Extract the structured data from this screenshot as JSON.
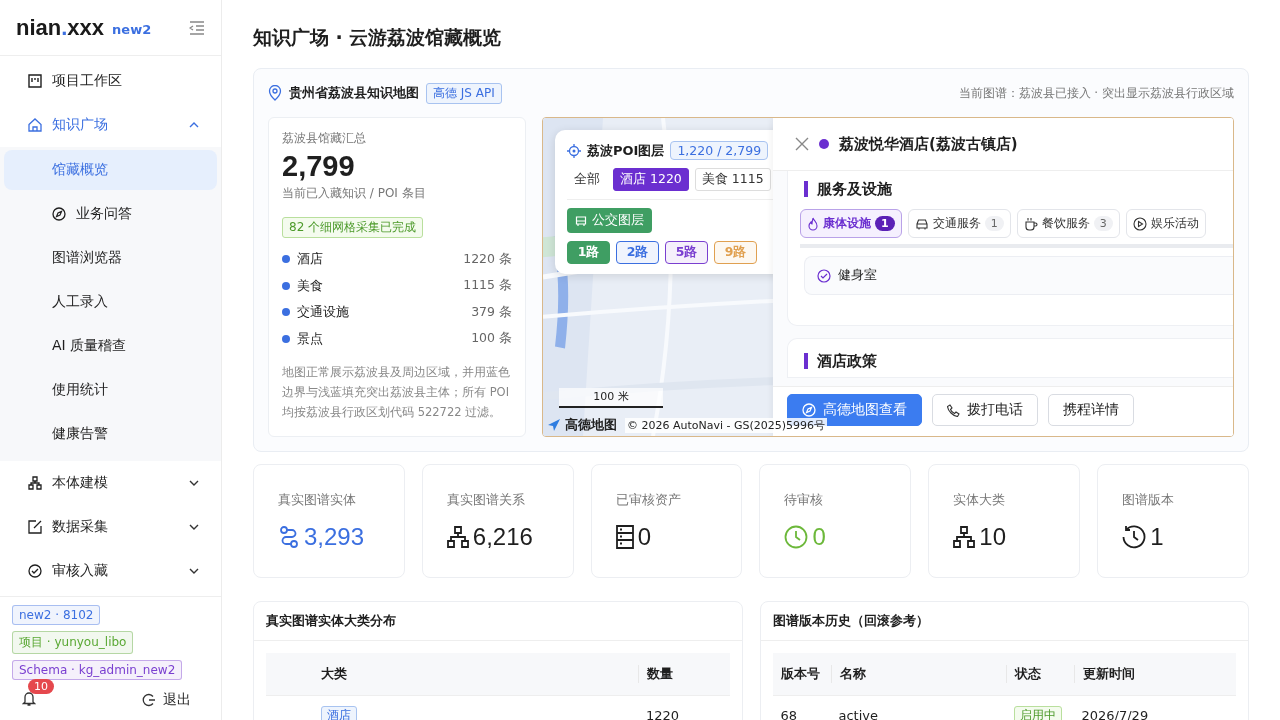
{
  "brand": {
    "name_before_dot": "nian",
    "dot": ".",
    "name_after_dot": "xxx",
    "env": "new2"
  },
  "sidebar": {
    "items": [
      {
        "label": "项目工作区",
        "selected": false
      },
      {
        "label": "知识广场",
        "expanded": true,
        "selected": true,
        "children": [
          {
            "label": "馆藏概览",
            "selected": true
          },
          {
            "label": "业务问答",
            "selected": false
          },
          {
            "label": "图谱浏览器",
            "selected": false
          },
          {
            "label": "人工录入",
            "selected": false
          },
          {
            "label": "AI 质量稽查",
            "selected": false
          },
          {
            "label": "使用统计",
            "selected": false
          },
          {
            "label": "健康告警",
            "selected": false
          }
        ]
      },
      {
        "label": "本体建模",
        "expanded": false,
        "selected": false
      },
      {
        "label": "数据采集",
        "expanded": false,
        "selected": false
      },
      {
        "label": "审核入藏",
        "expanded": false,
        "selected": false
      }
    ]
  },
  "env_tags": [
    {
      "label": "new2 · 8102",
      "color": "#3b6fe0"
    },
    {
      "label": "项目 · yunyou_libo",
      "color": "#5aa834"
    },
    {
      "label": "Schema · kg_admin_new2",
      "color": "#7a3fd0"
    }
  ],
  "footer": {
    "notification_count": "10",
    "logout": "退出"
  },
  "page_title": "知识广场 · 云游荔波馆藏概览",
  "map_card": {
    "title": "贵州省荔波县知识地图",
    "badge": "高德 JS API",
    "note": "当前图谱：荔波县已接入 · 突出显示荔波县行政区域",
    "summary": {
      "label": "荔波县馆藏汇总",
      "total": "2,799",
      "subtitle": "当前已入藏知识 / POI 条目",
      "grid_badge": "82 个细网格采集已完成",
      "categories": [
        {
          "name": "酒店",
          "count": "1220 条",
          "color": "#3b6fe0"
        },
        {
          "name": "美食",
          "count": "1115 条",
          "color": "#3b6fe0"
        },
        {
          "name": "交通设施",
          "count": "379 条",
          "color": "#3b6fe0"
        },
        {
          "name": "景点",
          "count": "100 条",
          "color": "#3b6fe0"
        }
      ],
      "note": "地图正常展示荔波县及周边区域，并用蓝色边界与浅蓝填充突出荔波县主体；所有 POI 均按荔波县行政区划代码 522722 过滤。"
    },
    "map": {
      "kind": "picture",
      "poi_layer": {
        "title": "荔波POI图层",
        "count": "1,220 / 2,799",
        "filters": [
          {
            "label": "全部",
            "selected": false
          },
          {
            "label": "酒店 1220",
            "selected": true
          },
          {
            "label": "美食 1115",
            "selected": false
          }
        ],
        "bus_layer": "公交图层",
        "routes": [
          {
            "label": "1路",
            "selected": true,
            "color": "#3f9e63"
          },
          {
            "label": "2路",
            "selected": false,
            "color": "#3b6fe0"
          },
          {
            "label": "5路",
            "selected": false,
            "color": "#7a3fd0"
          },
          {
            "label": "9路",
            "selected": false,
            "color": "#e0a050"
          }
        ]
      },
      "scale": "100 米",
      "provider": "高德地图",
      "copyright": "© 2026 AutoNavi - GS(2025)5996号"
    },
    "detail": {
      "title": "荔波悦华酒店(荔波古镇店)",
      "color": "#6b2fd0",
      "facility_section": "服务及设施",
      "tabs": [
        {
          "label": "康体设施",
          "count": "1",
          "selected": true
        },
        {
          "label": "交通服务",
          "count": "1",
          "selected": false
        },
        {
          "label": "餐饮服务",
          "count": "3",
          "selected": false
        },
        {
          "label": "娱乐活动",
          "selected": false
        }
      ],
      "facilities": [
        "健身室"
      ],
      "policy_section": "酒店政策",
      "buttons": [
        {
          "label": "高德地图查看",
          "kind": "primary"
        },
        {
          "label": "拨打电话",
          "kind": "phone"
        },
        {
          "label": "携程详情",
          "kind": "plain"
        }
      ]
    }
  },
  "stats": [
    {
      "label": "真实图谱实体",
      "value": "3,293",
      "color": "#3b6fe0"
    },
    {
      "label": "真实图谱关系",
      "value": "6,216",
      "color": "#1f1f1f"
    },
    {
      "label": "已审核资产",
      "value": "0",
      "color": "#1f1f1f"
    },
    {
      "label": "待审核",
      "value": "0",
      "color": "#6cb83a"
    },
    {
      "label": "实体大类",
      "value": "10",
      "color": "#1f1f1f"
    },
    {
      "label": "图谱版本",
      "value": "1",
      "color": "#1f1f1f"
    }
  ],
  "category_table": {
    "title": "真实图谱实体大类分布",
    "columns": [
      "大类",
      "数量"
    ],
    "rows": [
      {
        "category": "酒店",
        "count": "1220"
      }
    ]
  },
  "version_table": {
    "title": "图谱版本历史（回滚参考）",
    "columns": [
      "版本号",
      "名称",
      "状态",
      "更新时间"
    ],
    "rows": [
      {
        "version": "68",
        "name": "active",
        "status": "启用中",
        "updated": "2026/7/29"
      }
    ]
  }
}
